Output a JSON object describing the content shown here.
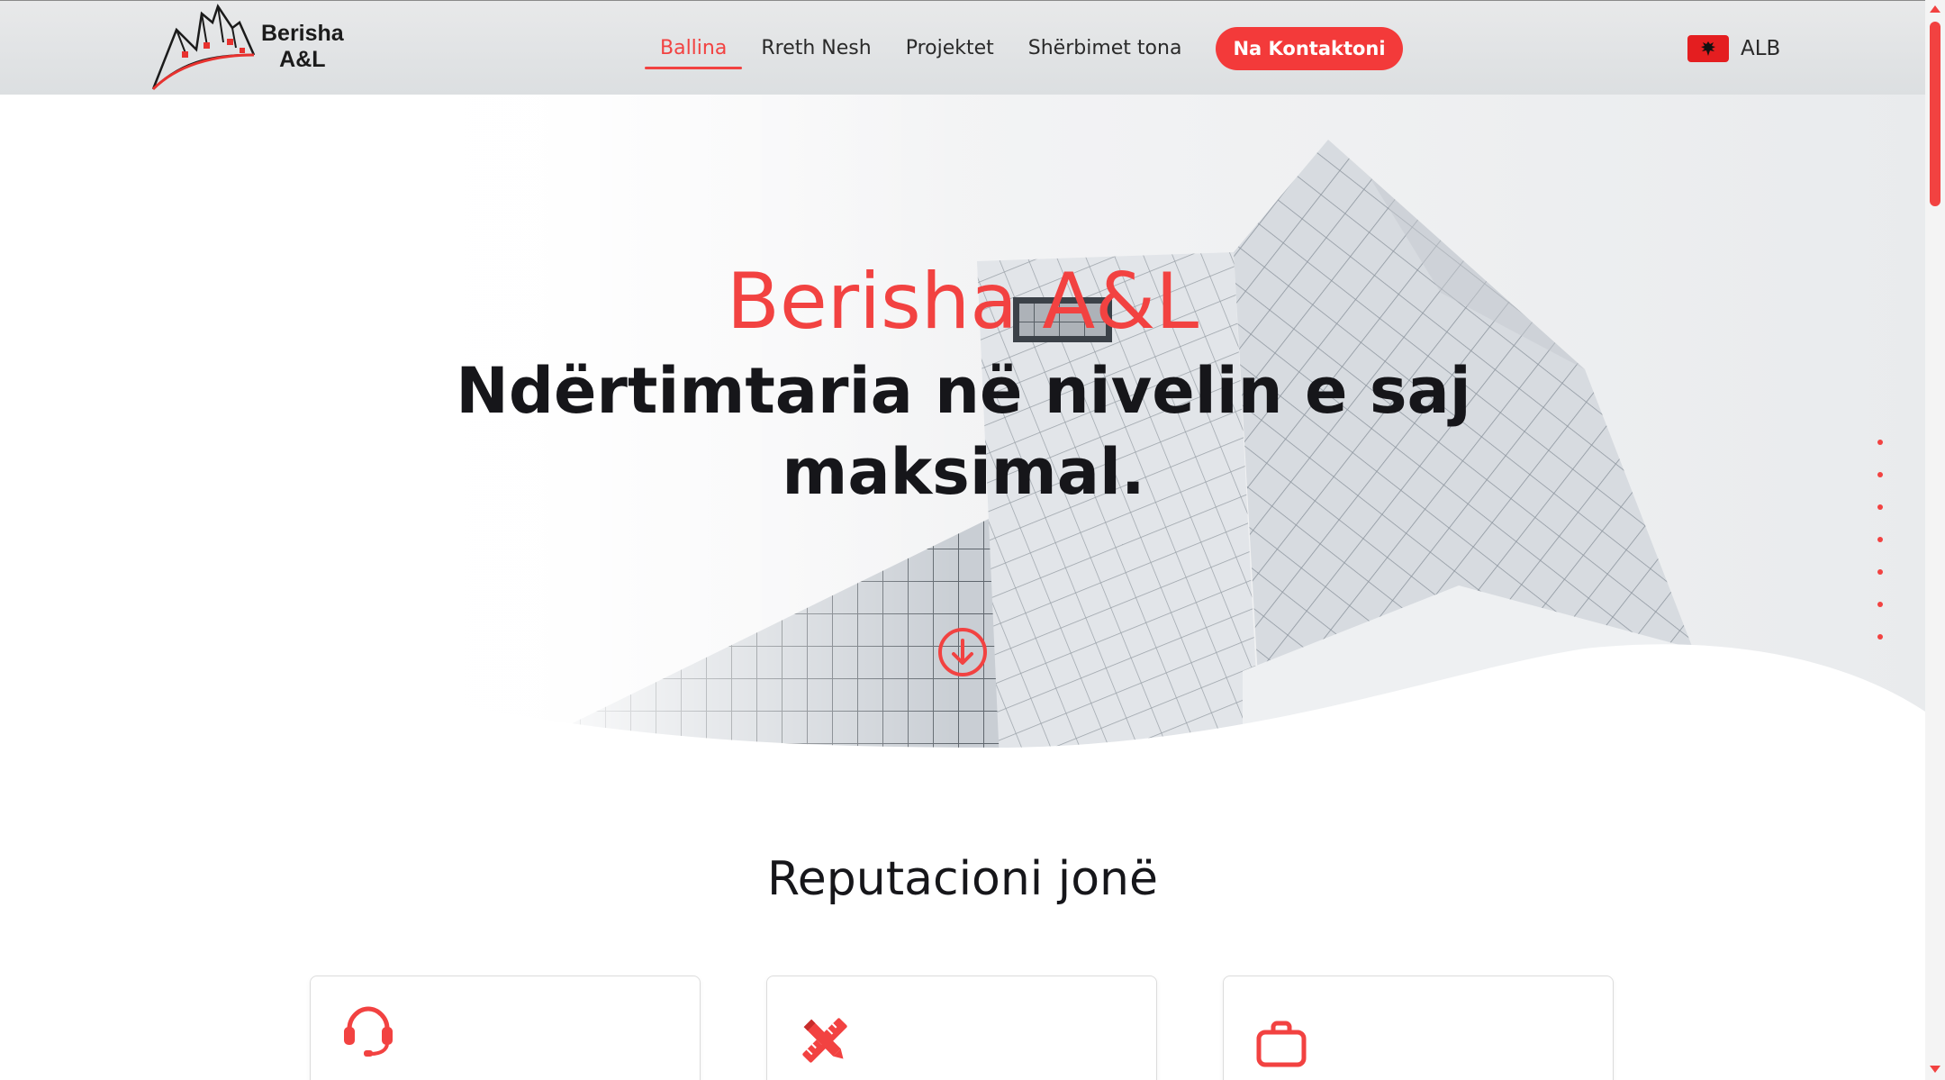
{
  "brand": {
    "name_line1": "Berisha",
    "name_line2": "A&L"
  },
  "nav": {
    "items": [
      {
        "label": "Ballina",
        "active": true
      },
      {
        "label": "Rreth Nesh",
        "active": false
      },
      {
        "label": "Projektet",
        "active": false
      },
      {
        "label": "Shërbimet tona",
        "active": false
      }
    ],
    "cta_label": "Na Kontaktoni"
  },
  "language": {
    "label": "ALB",
    "flag_icon": "albania-flag-icon"
  },
  "hero": {
    "title": "Berisha A&L",
    "subtitle": "Ndërtimtaria në nivelin e saj maksimal.",
    "scroll_icon": "arrow-down-circle-icon"
  },
  "side_dots": {
    "count": 7
  },
  "reputation": {
    "title": "Reputacioni jonë",
    "cards": [
      {
        "icon": "headset-icon"
      },
      {
        "icon": "pencil-ruler-icon"
      },
      {
        "icon": "briefcase-icon"
      }
    ]
  },
  "colors": {
    "accent": "#f24241",
    "text": "#16161a",
    "header_bg": "#e0e2e4"
  }
}
